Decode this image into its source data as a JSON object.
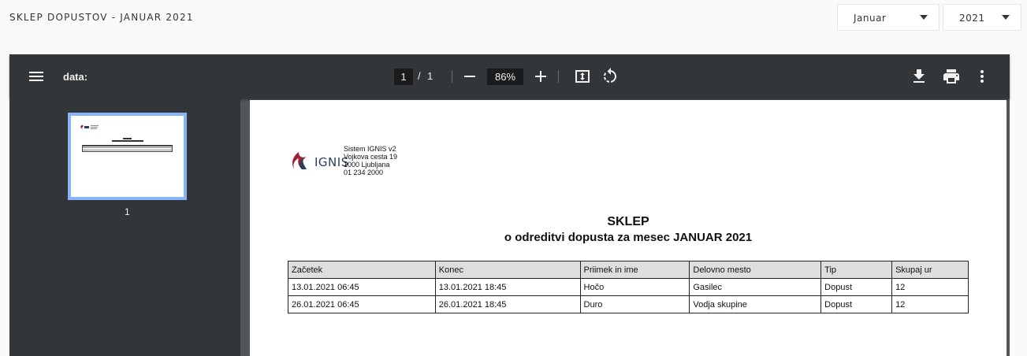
{
  "header": {
    "title": "SKLEP DOPUSTOV - JANUAR 2021",
    "month_select": "Januar",
    "year_select": "2021"
  },
  "viewer": {
    "doc_title": "data:",
    "current_page": "1",
    "page_separator": "/",
    "total_pages": "1",
    "zoom": "86%",
    "thumbnail_label": "1",
    "icons": [
      "menu-icon",
      "zoom-out-icon",
      "zoom-in-icon",
      "fit-page-icon",
      "rotate-icon",
      "download-icon",
      "print-icon",
      "more-icon"
    ]
  },
  "document": {
    "company_lines": [
      "Sistem IGNIS v2",
      "Vojkova cesta 19",
      "1000 Ljubljana",
      "01 234 2000"
    ],
    "logo_text": "IGNIS",
    "heading": "SKLEP",
    "subheading": "o odreditvi dopusta za mesec JANUAR 2021",
    "table": {
      "columns": [
        "Začetek",
        "Konec",
        "Priimek in ime",
        "Delovno mesto",
        "Tip",
        "Skupaj ur"
      ],
      "rows": [
        [
          "13.01.2021 06:45",
          "13.01.2021 18:45",
          "Hočo",
          "Gasilec",
          "Dopust",
          "12"
        ],
        [
          "26.01.2021 06:45",
          "26.01.2021 18:45",
          "Duro",
          "Vodja skupine",
          "Dopust",
          "12"
        ]
      ]
    }
  },
  "colors": {
    "toolbar": "#323639",
    "viewer_bg": "#525659",
    "thumbnail_border": "#8ab4f8",
    "logo_red": "#9b2335",
    "logo_navy": "#2b3e5a"
  }
}
